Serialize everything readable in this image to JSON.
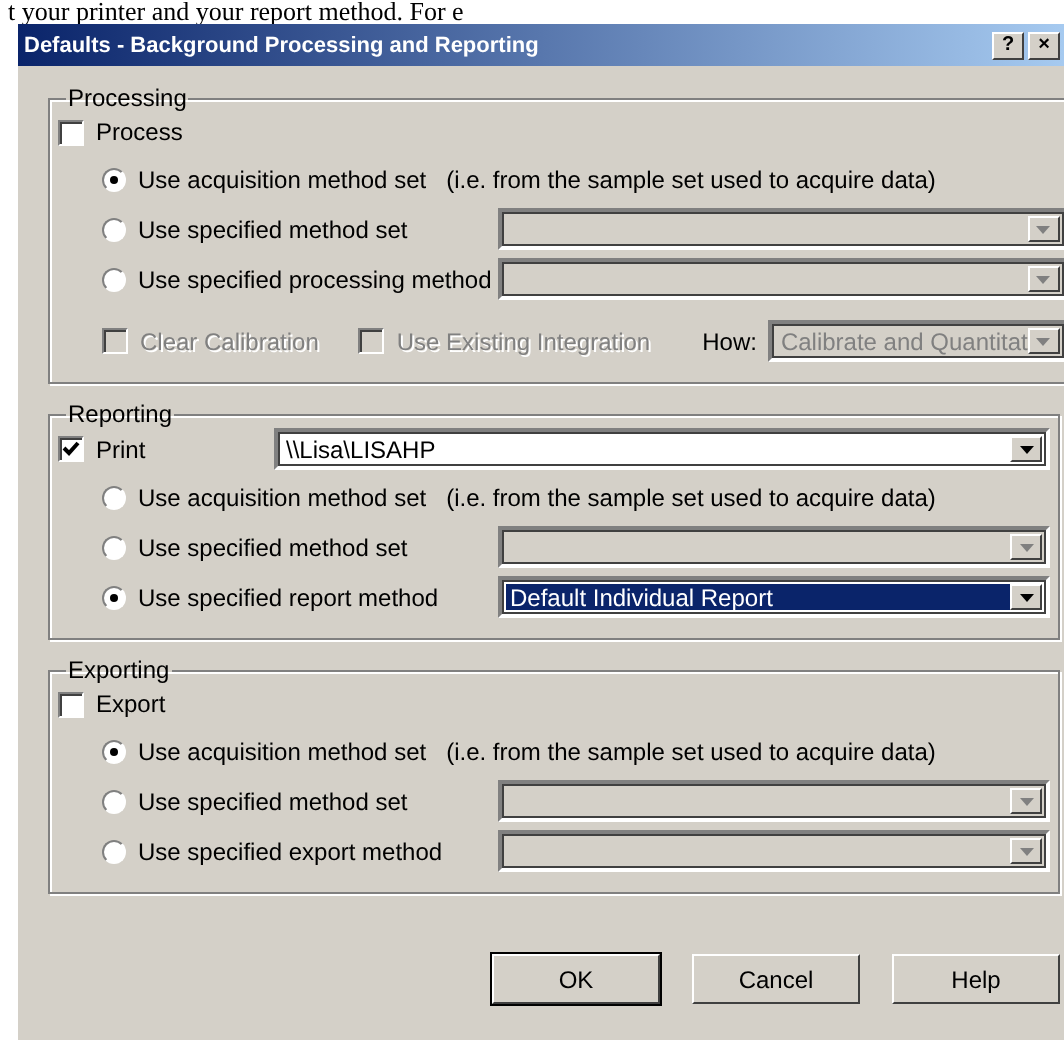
{
  "background_text": "t your printer and your report  method. For e",
  "window": {
    "title": "Defaults - Background Processing and Reporting",
    "title_buttons": [
      "?",
      "×"
    ]
  },
  "sections": [
    {
      "title": "Processing",
      "toggle": {
        "label": "Process",
        "checked": false
      },
      "options": [
        {
          "label": "Use acquisition method set",
          "note": "(i.e. from the sample set used to acquire data)",
          "selected": true
        },
        {
          "label": "Use specified method set",
          "selected": false,
          "dropdown": {
            "disabled": true
          }
        },
        {
          "label": "Use specified processing method",
          "selected": false,
          "dropdown": {
            "disabled": true
          }
        }
      ],
      "extras": {
        "checkboxes": [
          {
            "label": "Clear Calibration",
            "checked": false,
            "disabled": true
          },
          {
            "label": "Use Existing Integration",
            "checked": false,
            "disabled": true
          }
        ],
        "how_label": "How:",
        "how_dropdown": {
          "value": "Calibrate and Quantitat",
          "disabled": true
        }
      }
    },
    {
      "title": "Reporting",
      "toggle": {
        "label": "Print",
        "checked": true,
        "dropdown": {
          "value": "\\\\Lisa\\LISAHP",
          "disabled": false
        }
      },
      "options": [
        {
          "label": "Use acquisition method set",
          "note": "(i.e. from the sample set used to acquire data)",
          "selected": false
        },
        {
          "label": "Use specified method set",
          "selected": false,
          "dropdown": {
            "disabled": true
          }
        },
        {
          "label": "Use specified report method",
          "selected": true,
          "dropdown": {
            "value": "Default Individual Report",
            "disabled": false,
            "highlighted": true
          }
        }
      ]
    },
    {
      "title": "Exporting",
      "toggle": {
        "label": "Export",
        "checked": false
      },
      "options": [
        {
          "label": "Use acquisition method set",
          "note": "(i.e. from the sample set used to acquire data)",
          "selected": true
        },
        {
          "label": "Use specified method set",
          "selected": false,
          "dropdown": {
            "disabled": true
          }
        },
        {
          "label": "Use specified export method",
          "selected": false,
          "dropdown": {
            "disabled": true
          }
        }
      ]
    }
  ],
  "buttons": [
    {
      "label": "OK",
      "default": true
    },
    {
      "label": "Cancel",
      "default": false
    },
    {
      "label": "Help",
      "default": false
    }
  ]
}
